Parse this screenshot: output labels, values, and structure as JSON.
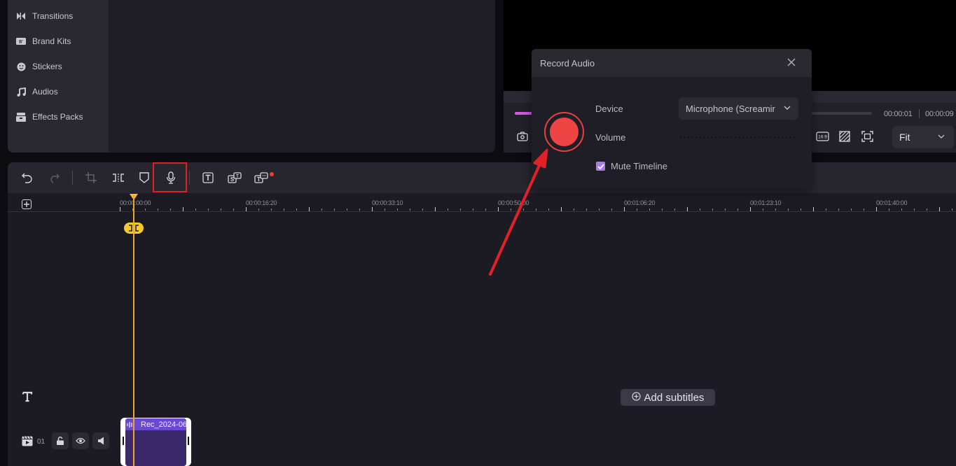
{
  "sidebar": {
    "items": [
      {
        "label": "Transitions",
        "icon": "transitions-icon"
      },
      {
        "label": "Brand Kits",
        "icon": "brand-kit-icon"
      },
      {
        "label": "Stickers",
        "icon": "sticker-icon"
      },
      {
        "label": "Audios",
        "icon": "music-note-icon"
      },
      {
        "label": "Effects Packs",
        "icon": "effects-pack-icon"
      }
    ]
  },
  "preview": {
    "current_time": "00:00:01",
    "total_time": "00:00:09",
    "progress_fraction": 0.06,
    "aspect_ratio_label": "16:9",
    "zoom_select": "Fit"
  },
  "toolbar": {
    "tools": [
      "undo",
      "redo",
      "crop",
      "split",
      "mask",
      "record-audio",
      "text",
      "subtitle",
      "text-to-speech"
    ],
    "highlighted_tool": "record-audio"
  },
  "timeline": {
    "ruler_labels": [
      "00:00:00:00",
      "00:00:16:20",
      "00:00:33:10",
      "00:00:50:00",
      "00:01:06:20",
      "00:01:23:10",
      "00:01:40:00"
    ],
    "add_subtitles_label": "Add subtitles",
    "track_number": "01",
    "clip_name": "Rec_2024-06"
  },
  "record_dialog": {
    "title": "Record Audio",
    "device_label": "Device",
    "device_value": "Microphone (Screamir",
    "volume_label": "Volume",
    "mute_label": "Mute Timeline",
    "mute_checked": true
  },
  "colors": {
    "record_red": "#ef4444",
    "accent_purple": "#a47bea",
    "playhead": "#f6c02a",
    "annotation_red": "#e02020"
  }
}
